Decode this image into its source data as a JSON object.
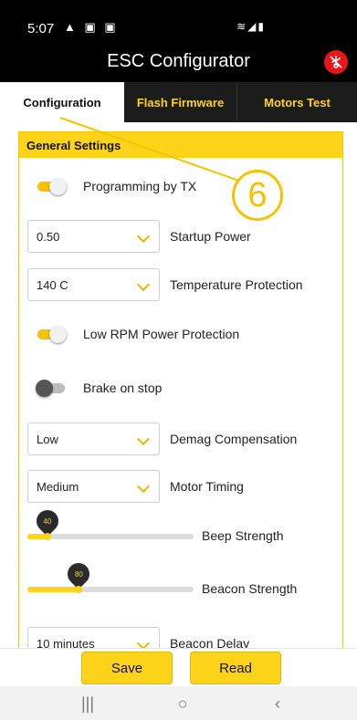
{
  "status_bar": {
    "time": "5:07",
    "left_icons": "▲ ▣ ▣",
    "right_icons": "≋◢▮"
  },
  "app_bar": {
    "title": "ESC Configurator"
  },
  "tabs": [
    {
      "label": "Configuration",
      "active": true
    },
    {
      "label": "Flash Firmware",
      "active": false
    },
    {
      "label": "Motors Test",
      "active": false
    }
  ],
  "panel": {
    "title": "General Settings",
    "programming_by_tx": {
      "label": "Programming by TX",
      "on": true
    },
    "startup_power": {
      "value": "0.50",
      "label": "Startup Power"
    },
    "temperature_protection": {
      "value": "140 C",
      "label": "Temperature Protection"
    },
    "low_rpm_protection": {
      "label": "Low RPM Power Protection",
      "on": true
    },
    "brake_on_stop": {
      "label": "Brake on stop",
      "on": false
    },
    "demag_compensation": {
      "value": "Low",
      "label": "Demag Compensation"
    },
    "motor_timing": {
      "value": "Medium",
      "label": "Motor Timing"
    },
    "beep_strength": {
      "value": "40",
      "label": "Beep Strength",
      "fraction": 0.12
    },
    "beacon_strength": {
      "value": "80",
      "label": "Beacon Strength",
      "fraction": 0.31
    },
    "beacon_delay": {
      "value": "10 minutes",
      "label": "Beacon Delay"
    }
  },
  "actions": {
    "save": "Save",
    "read": "Read"
  },
  "callout": {
    "number": "6"
  },
  "icons": {
    "usb": "usb-disconnected-icon",
    "nav_recents": "|||",
    "nav_home": "○",
    "nav_back": "‹"
  },
  "colors": {
    "accent": "#ffd31a",
    "dark": "#1c1c1c",
    "alert": "#e8161b"
  }
}
